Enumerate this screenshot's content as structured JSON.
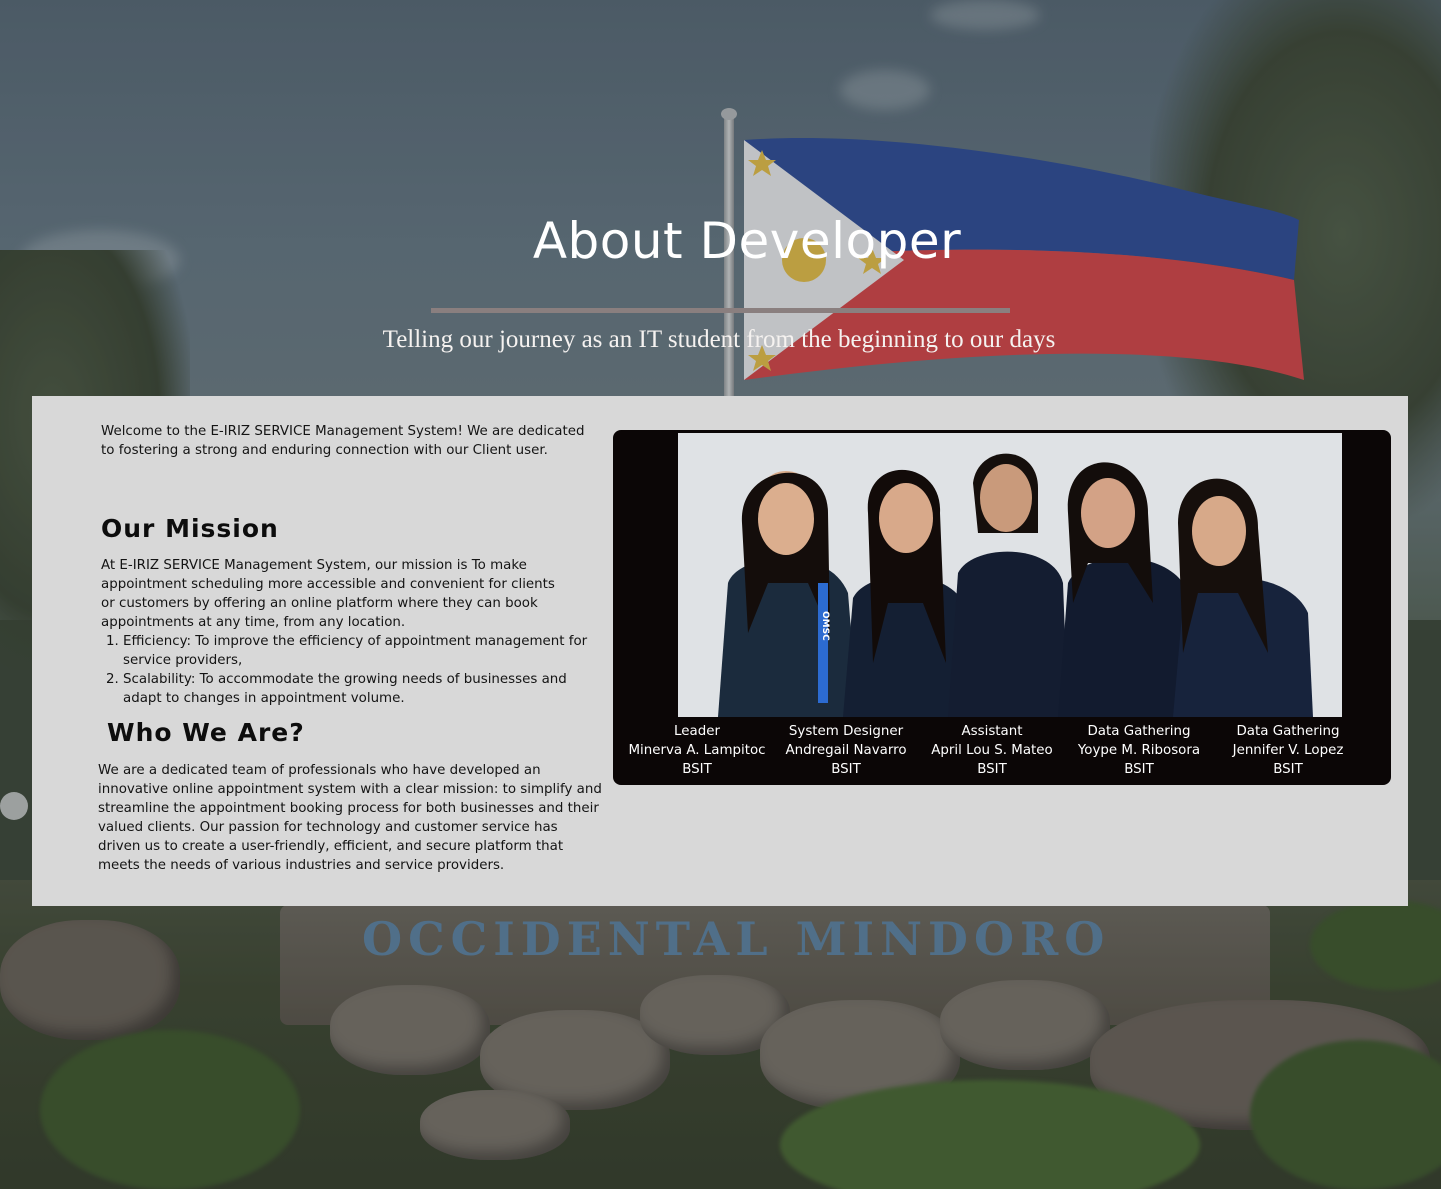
{
  "hero": {
    "title": "About Developer",
    "subtitle": "Telling our journey as an IT student from the beginning to our days"
  },
  "background": {
    "sign_text": "OCCIDENTAL  MINDORO"
  },
  "intro": {
    "welcome": "Welcome to the E-IRIZ SERVICE Management System! We are dedicated to fostering a strong and enduring connection with our Client user."
  },
  "mission": {
    "heading": "Our Mission",
    "body": "At E-IRIZ SERVICE Management System, our mission is  To make appointment scheduling more accessible and convenient for clients or customers by offering an online platform where they can book appointments at any time, from any location.",
    "items": [
      "Efficiency: To improve the efficiency of appointment management for service providers,",
      "Scalability: To accommodate the growing needs of businesses and adapt to changes in appointment volume."
    ]
  },
  "who": {
    "heading": "Who We Are?",
    "body": "We are a dedicated team of professionals who have developed an innovative online appointment system with a clear mission: to simplify and streamline the appointment booking process for both businesses and their valued clients. Our passion for technology and customer service has driven us to create a user-friendly, efficient, and secure platform that meets the needs of various industries and service providers."
  },
  "team": {
    "photo_badge": "OMSC",
    "members": [
      {
        "role": "Leader",
        "name": "Minerva A. Lampitoc",
        "course": "BSIT"
      },
      {
        "role": "System Designer",
        "name": "Andregail Navarro",
        "course": "BSIT"
      },
      {
        "role": "Assistant",
        "name": "April Lou S. Mateo",
        "course": "BSIT"
      },
      {
        "role": "Data Gathering",
        "name": "Yoype M. Ribosora",
        "course": "BSIT"
      },
      {
        "role": "Data Gathering",
        "name": "Jennifer V. Lopez",
        "course": "BSIT"
      }
    ]
  },
  "colors": {
    "panel": "#d8d8d8",
    "card": "#0b0606",
    "rule": "#8a7f7f",
    "flag_blue": "#2f4f9a",
    "flag_red": "#d8474a"
  }
}
